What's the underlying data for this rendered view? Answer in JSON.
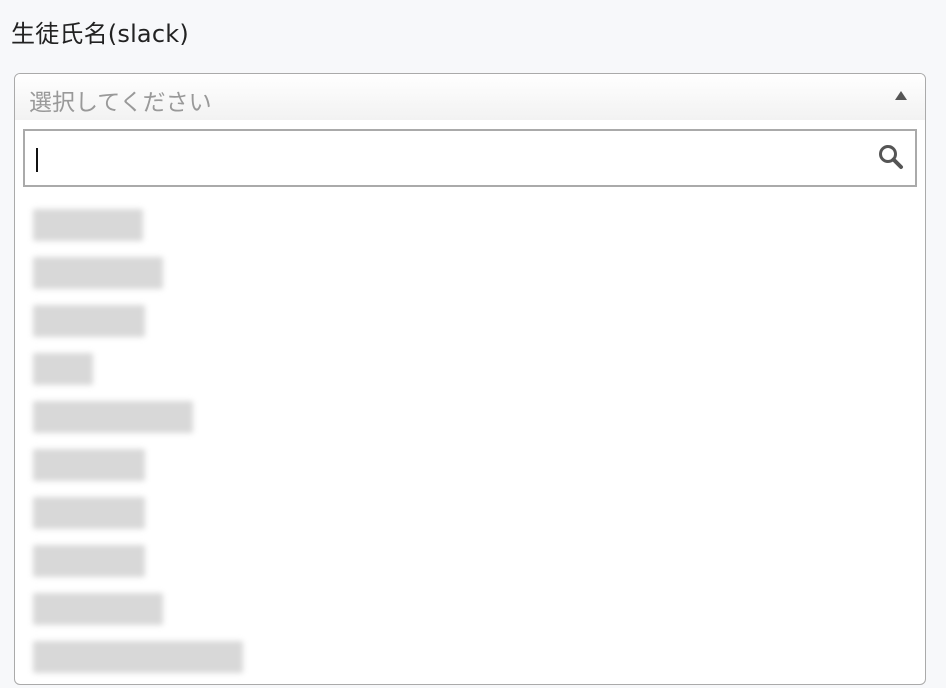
{
  "field": {
    "label": "生徒氏名(slack)",
    "placeholder": "選択してください"
  },
  "search": {
    "value": "",
    "icon": "search-icon"
  },
  "options": [
    {
      "label": "",
      "redacted": true
    },
    {
      "label": "",
      "redacted": true
    },
    {
      "label": "",
      "redacted": true
    },
    {
      "label": "",
      "redacted": true
    },
    {
      "label": "",
      "redacted": true
    },
    {
      "label": "",
      "redacted": true
    },
    {
      "label": "",
      "redacted": true
    },
    {
      "label": "",
      "redacted": true
    },
    {
      "label": "",
      "redacted": true
    },
    {
      "label": "",
      "redacted": true
    }
  ],
  "colors": {
    "background": "#f7f8fa",
    "border": "#aaaaaa",
    "placeholder": "#999999"
  }
}
